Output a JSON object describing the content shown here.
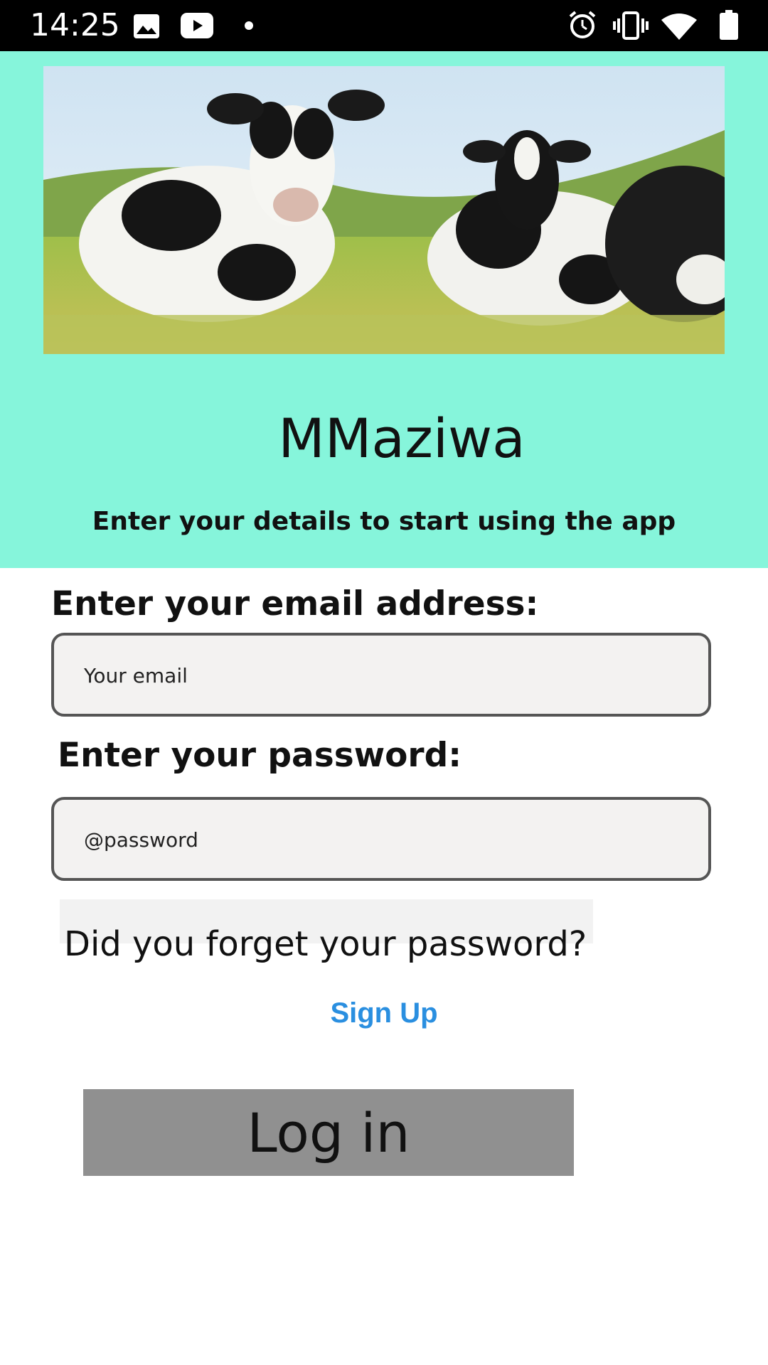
{
  "status_bar": {
    "time": "14:25",
    "left_icons": [
      "image-icon",
      "youtube-icon",
      "dot-icon"
    ],
    "right_icons": [
      "alarm-icon",
      "vibrate-icon",
      "wifi-icon",
      "battery-icon"
    ]
  },
  "header": {
    "hero_image": "cows-in-pasture",
    "background_color": "#86f5db",
    "title": "MMaziwa",
    "subtitle": "Enter your details to start using the app"
  },
  "form": {
    "email_label": "Enter your email address:",
    "email_placeholder": "Your email",
    "password_label": "Enter your password:",
    "password_placeholder": "@password",
    "forgot_link": "Did you forget your password?",
    "signup_link": "Sign Up",
    "login_button": "Log in"
  },
  "colors": {
    "accent_link": "#2a8fe0",
    "button_bg": "#909090"
  }
}
